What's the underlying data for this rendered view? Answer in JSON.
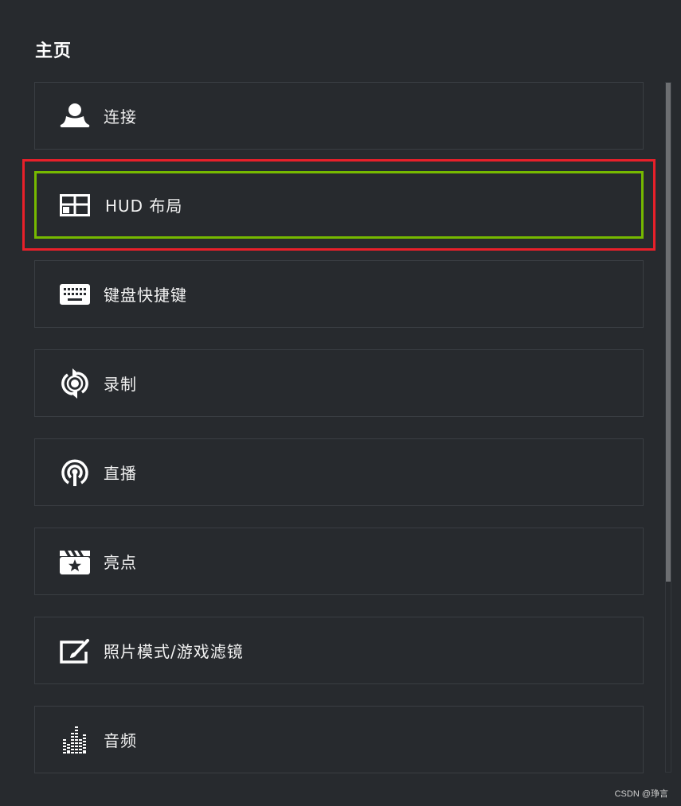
{
  "page": {
    "title": "主页"
  },
  "menu": {
    "items": [
      {
        "label": "连接",
        "icon": "user-icon"
      },
      {
        "label": "HUD 布局",
        "icon": "layout-icon",
        "selected": true
      },
      {
        "label": "键盘快捷键",
        "icon": "keyboard-icon"
      },
      {
        "label": "录制",
        "icon": "record-icon"
      },
      {
        "label": "直播",
        "icon": "broadcast-icon"
      },
      {
        "label": "亮点",
        "icon": "clapperboard-star-icon"
      },
      {
        "label": "照片模式/游戏滤镜",
        "icon": "photo-edit-icon"
      },
      {
        "label": "音频",
        "icon": "equalizer-icon"
      }
    ]
  },
  "colors": {
    "background": "#272a2e",
    "selected_border": "#76b900",
    "highlight_outline": "#e8202a"
  },
  "watermark": "CSDN @琤言"
}
